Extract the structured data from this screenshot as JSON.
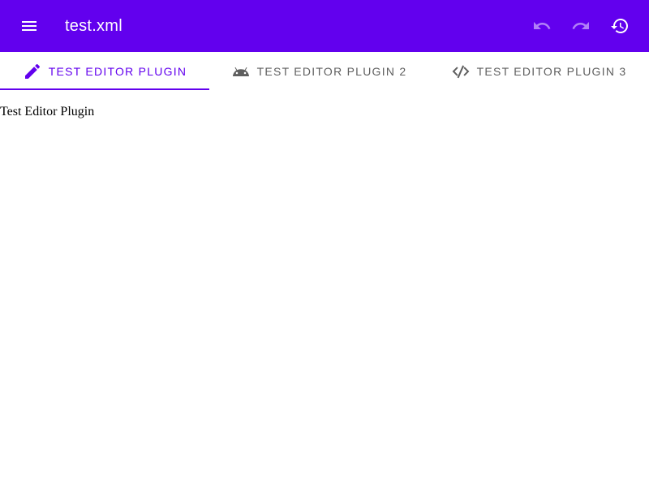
{
  "app_bar": {
    "title": "test.xml",
    "background_color": "#6200ee",
    "menu_icon": "menu-icon",
    "actions": [
      {
        "name": "undo",
        "icon": "undo-icon",
        "enabled": false
      },
      {
        "name": "redo",
        "icon": "redo-icon",
        "enabled": false
      },
      {
        "name": "history",
        "icon": "history-icon",
        "enabled": true
      }
    ]
  },
  "tabs": [
    {
      "label": "Test Editor Plugin",
      "icon": "pencil-icon",
      "active": true
    },
    {
      "label": "Test Editor Plugin 2",
      "icon": "android-icon",
      "active": false
    },
    {
      "label": "Test Editor Plugin 3",
      "icon": "code-slash-icon",
      "active": false
    }
  ],
  "active_color": "#6200ee",
  "content": {
    "text": "Test Editor Plugin"
  }
}
